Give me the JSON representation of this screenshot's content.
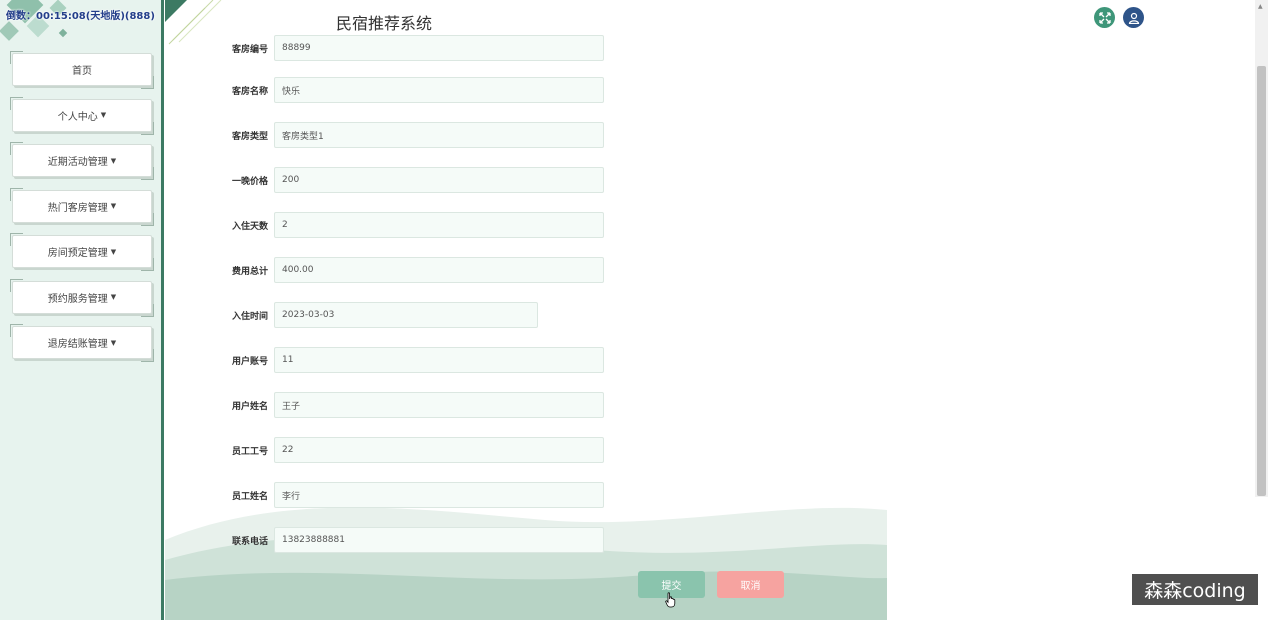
{
  "status_text": "倒数：00:15:08(天地版)(888)",
  "app_title": "民宿推荐系统",
  "header_icons": [
    "expand-icon",
    "user-icon"
  ],
  "sidebar": {
    "items": [
      {
        "label": "首页",
        "caret": ""
      },
      {
        "label": "个人中心",
        "caret": "▼"
      },
      {
        "label": "近期活动管理",
        "caret": "▼"
      },
      {
        "label": "热门客房管理",
        "caret": "▼"
      },
      {
        "label": "房间预定管理",
        "caret": "▼"
      },
      {
        "label": "预约服务管理",
        "caret": "▼"
      },
      {
        "label": "退房结账管理",
        "caret": "▼"
      }
    ]
  },
  "form": {
    "fields": [
      {
        "label": "客房编号",
        "value": "88899"
      },
      {
        "label": "客房名称",
        "value": "快乐"
      },
      {
        "label": "客房类型",
        "value": "客房类型1"
      },
      {
        "label": "一晚价格",
        "value": "200"
      },
      {
        "label": "入住天数",
        "value": "2"
      },
      {
        "label": "费用总计",
        "value": "400.00"
      },
      {
        "label": "入住时间",
        "value": "2023-03-03"
      },
      {
        "label": "用户账号",
        "value": "11"
      },
      {
        "label": "用户姓名",
        "value": "王子"
      },
      {
        "label": "员工工号",
        "value": "22"
      },
      {
        "label": "员工姓名",
        "value": "李行"
      },
      {
        "label": "联系电话",
        "value": "13823888881"
      }
    ],
    "submit_label": "提交",
    "cancel_label": "取消"
  },
  "watermark": "森森coding",
  "colors": {
    "sidebar_bg": "#e7f3ee",
    "accent": "#3c7a63",
    "submit": "#8ac4ad",
    "cancel": "#f6a3a0",
    "expand_btn": "#3e9679",
    "user_btn": "#2e5489"
  }
}
